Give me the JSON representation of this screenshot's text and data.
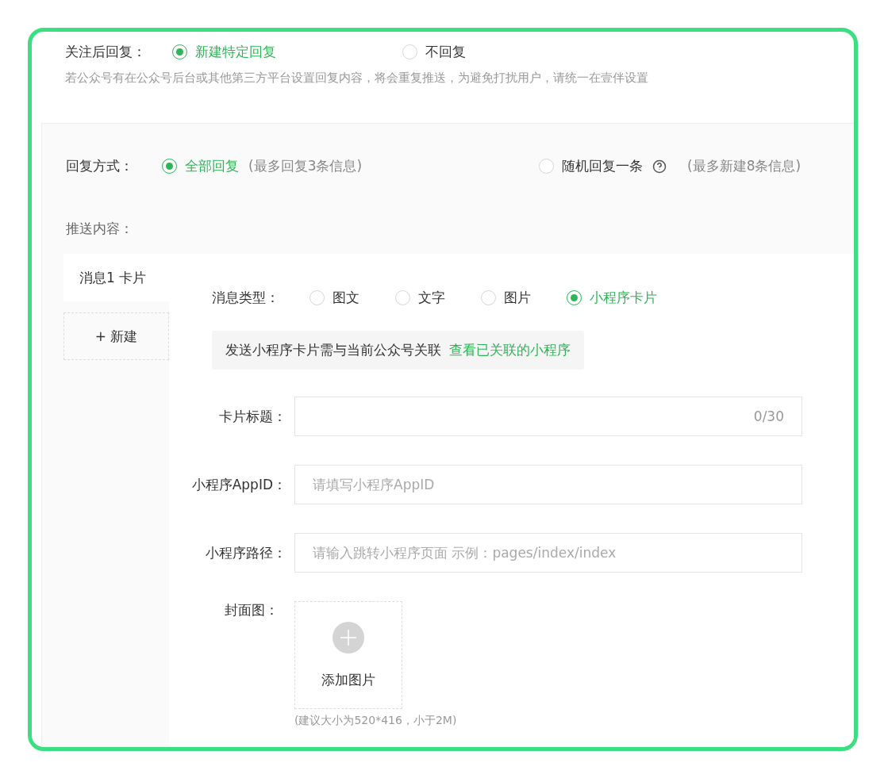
{
  "follow_reply": {
    "label": "关注后回复：",
    "options": [
      {
        "label": "新建特定回复",
        "selected": true
      },
      {
        "label": "不回复",
        "selected": false
      }
    ],
    "note": "若公众号有在公众号后台或其他第三方平台设置回复内容，将会重复推送，为避免打扰用户，请统一在壹伴设置"
  },
  "reply_mode": {
    "label": "回复方式：",
    "options": [
      {
        "label": "全部回复",
        "hint": "(最多回复3条信息)",
        "help": false,
        "selected": true
      },
      {
        "label": "随机回复一条",
        "hint": "(最多新建8条信息)",
        "help": true,
        "selected": false
      }
    ]
  },
  "push_content": {
    "label": "推送内容：",
    "messages": [
      {
        "label": "消息1 卡片",
        "selected": true
      }
    ],
    "add_button": "+ 新建"
  },
  "message_type": {
    "label": "消息类型：",
    "options": [
      {
        "label": "图文",
        "selected": false
      },
      {
        "label": "文字",
        "selected": false
      },
      {
        "label": "图片",
        "selected": false
      },
      {
        "label": "小程序卡片",
        "selected": true
      }
    ]
  },
  "notice": {
    "text": "发送小程序卡片需与当前公众号关联",
    "link": "查看已关联的小程序"
  },
  "fields": [
    {
      "label": "卡片标题：",
      "counter": "0/30"
    },
    {
      "label": "小程序AppID：",
      "placeholder": "请填写小程序AppID"
    },
    {
      "label": "小程序路径：",
      "placeholder": "请输入跳转小程序页面 示例：pages/index/index"
    }
  ],
  "cover": {
    "label": "封面图：",
    "button": "添加图片",
    "hint": "(建议大小为520*416，小于2M)"
  }
}
